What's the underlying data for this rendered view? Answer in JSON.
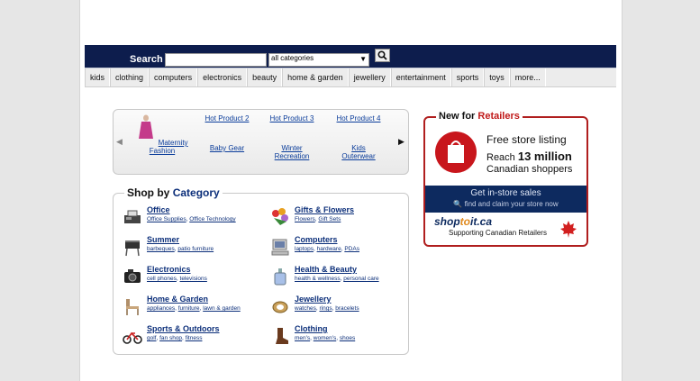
{
  "search": {
    "label": "Search",
    "input_value": "",
    "category_selected": "all categories"
  },
  "nav": {
    "tabs": [
      "kids",
      "clothing",
      "computers",
      "electronics",
      "beauty",
      "home & garden",
      "jewellery",
      "entertainment",
      "sports",
      "toys",
      "more..."
    ]
  },
  "carousel": {
    "items": [
      {
        "alt": "",
        "label_line1": "Maternity",
        "label_line2": "Fashion"
      },
      {
        "alt": "Hot Product 2",
        "label_line1": "Baby Gear",
        "label_line2": ""
      },
      {
        "alt": "Hot Product 3",
        "label_line1": "Winter",
        "label_line2": "Recreation"
      },
      {
        "alt": "Hot Product 4",
        "label_line1": "Kids",
        "label_line2": "Outerwear"
      }
    ]
  },
  "shop_by_category": {
    "title_prefix": "Shop by",
    "title_highlight": "Category",
    "categories": [
      {
        "name": "Office",
        "subs": [
          "Office Supplies",
          "Office Technology"
        ],
        "icon": "fax-machine-icon"
      },
      {
        "name": "Gifts & Flowers",
        "subs": [
          "Flowers",
          "Gift Sets"
        ],
        "icon": "flowers-icon"
      },
      {
        "name": "Summer",
        "subs": [
          "barbeques",
          "patio furniture"
        ],
        "icon": "barbeque-icon"
      },
      {
        "name": "Computers",
        "subs": [
          "laptops",
          "hardware",
          "PDAs"
        ],
        "icon": "computer-icon"
      },
      {
        "name": "Electronics",
        "subs": [
          "cell phones",
          "televisions"
        ],
        "icon": "camera-icon"
      },
      {
        "name": "Health & Beauty",
        "subs": [
          "health & wellness",
          "personal care"
        ],
        "icon": "perfume-icon"
      },
      {
        "name": "Home & Garden",
        "subs": [
          "appliances",
          "furniture",
          "lawn & garden"
        ],
        "icon": "chair-icon"
      },
      {
        "name": "Jewellery",
        "subs": [
          "watches",
          "rings",
          "bracelets"
        ],
        "icon": "jewellery-icon"
      },
      {
        "name": "Sports & Outdoors",
        "subs": [
          "golf",
          "fan shop",
          "fitness"
        ],
        "icon": "bike-icon"
      },
      {
        "name": "Clothing",
        "subs": [
          "men's",
          "women's",
          "shoes"
        ],
        "icon": "boot-icon"
      }
    ]
  },
  "ad": {
    "title_prefix": "New for",
    "title_highlight": "Retailers",
    "line1": "Free store listing",
    "line2_prefix": "Reach",
    "line2_bold": "13 million",
    "line3": "Canadian shoppers",
    "band_line1": "Get in-store sales",
    "band_line2": "find and claim your store now",
    "logo_shop": "shop",
    "logo_to": "to",
    "logo_it": "it.ca",
    "support_text": "Supporting Canadian Retailers"
  },
  "colors": {
    "navy": "#0d1d4d",
    "link": "#0c2f7a",
    "ad_red": "#b01e1e"
  }
}
